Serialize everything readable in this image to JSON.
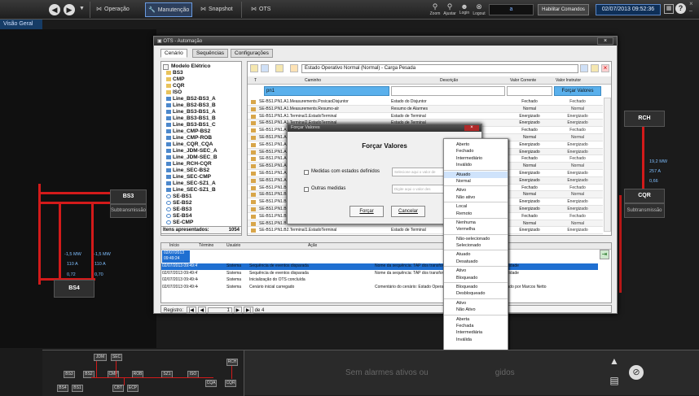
{
  "topbar": {
    "nav": {
      "operacao": "Operação",
      "manutencao": "Manutenção",
      "snapshot": "Snapshot",
      "ots": "OTS"
    },
    "tools": {
      "zoom": "Zoom",
      "ajustar": "Ajustar",
      "login": "Login",
      "logout": "Logout"
    },
    "user": "a",
    "habilitar": "Habilitar Comandos",
    "datetime": "02/07/2013 09:52:36"
  },
  "side_tab": "Visão Geral",
  "map": {
    "bs3": "BS3",
    "bs3_sub": "Subtransmissão",
    "bs4": "BS4",
    "rch": "RCH",
    "cqr": "CQR",
    "cqr_sub": "Subtransmissão",
    "m1": "-1,5 MW",
    "m2": "-1,5 MW",
    "m3": "110 A",
    "m4": "110 A",
    "m5": "0,72",
    "m6": "0,70",
    "m7": "19,2 MW",
    "m8": "257 A",
    "m9": "0,66"
  },
  "window": {
    "title": "OTS - Automação",
    "tabs": [
      "Cenário",
      "Sequências",
      "Configurações"
    ],
    "tree_root": "Modelo Elétrico",
    "tree": [
      "BS3",
      "CMP",
      "CQR",
      "ISO",
      "Line_BS2-BS3_A",
      "Line_BS2-BS3_B",
      "Line_BS3-BS1_A",
      "Line_BS3-BS1_B",
      "Line_BS3-BS1_C",
      "Line_CMP-BS2",
      "Line_CMP-ROB",
      "Line_CQR_CQA",
      "Line_JDM-SEC_A",
      "Line_JDM-SEC_B",
      "Line_RCH-CQR",
      "Line_SEC-BS2",
      "Line_SEC-CMP",
      "Line_SEC-SZ1_A",
      "Line_SEC-SZ1_B",
      "SE-BS1",
      "SE-BS2",
      "SE-BS3",
      "SE-BS4",
      "SE-CMP"
    ],
    "items_label": "Itens apresentados:",
    "items_count": "1054",
    "combo": "Estado Operativo Normal (Normal) - Carga Pesada",
    "cols": {
      "t": "T",
      "caminho": "Caminho",
      "descricao": "Descrição",
      "valor_corrente": "Valor Corrente",
      "valor_instrutor": "Valor Instrutor"
    },
    "filter_text": "pn1",
    "forcar_valores": "Forçar Valores",
    "rows": [
      [
        "SE-BS1.PN1.A1.Measurements.PosicaoDisjuntor",
        "Estado do Disjuntor",
        "Fechado",
        "Fechado"
      ],
      [
        "SE-BS1.PN1.A1.Measurements.Resumo-alr",
        "Resumo de Alarmes",
        "Normal",
        "Normal"
      ],
      [
        "SE-BS1.PN1.A1.Terminal1.EstadoTerminal",
        "Estado de Terminal",
        "Energizado",
        "Energizado"
      ],
      [
        "SE-BS1.PN1.A1.Terminal2.EstadoTerminal",
        "Estado de Terminal",
        "Energizado",
        "Energizado"
      ],
      [
        "SE-BS1.PN1.A2.Measurements.PosicaoDisjuntor",
        "Estado do Disjuntor",
        "Fechado",
        "Fechado"
      ],
      [
        "SE-BS1.PN1.A2",
        "",
        "Normal",
        "Normal"
      ],
      [
        "SE-BS1.PN1.A2",
        "",
        "Energizado",
        "Energizado"
      ],
      [
        "SE-BS1.PN1.A2",
        "",
        "Energizado",
        "Energizado"
      ],
      [
        "SE-BS1.PN1.A3",
        "",
        "Fechado",
        "Fechado"
      ],
      [
        "SE-BS1.PN1.A3",
        "",
        "Normal",
        "Normal"
      ],
      [
        "SE-BS1.PN1.A3",
        "",
        "Energizado",
        "Energizado"
      ],
      [
        "SE-BS1.PN1.A3",
        "",
        "Energizado",
        "Energizado"
      ],
      [
        "SE-BS1.PN1.B",
        "",
        "Fechado",
        "Fechado"
      ],
      [
        "SE-BS1.PN1.B",
        "",
        "Normal",
        "Normal"
      ],
      [
        "SE-BS1.PN1.B",
        "",
        "Energizado",
        "Energizado"
      ],
      [
        "SE-BS1.PN1.B",
        "",
        "Energizado",
        "Energizado"
      ],
      [
        "SE-BS1.PN1.B1",
        "",
        "Fechado",
        "Fechado"
      ],
      [
        "SE-BS1.PN1.B1",
        "",
        "Normal",
        "Normal"
      ],
      [
        "SE-BS1.PN1.B2.Terminal1.EstadoTerminal",
        "Estado de Terminal",
        "Energizado",
        "Energizado"
      ]
    ],
    "ev_cols": {
      "inicio": "Início",
      "termino": "Término",
      "usuario": "Usuário",
      "acao": "Ação"
    },
    "ev_filter": "02/07/2013 09:49:24",
    "events": [
      [
        "02/07/2013 09:49:47",
        "Sistema",
        "Sequência de eventos disparada",
        "Nome da sequência: TAP dos transforma",
        "ualidade"
      ],
      [
        "02/07/2013 09:49:47",
        "Sistema",
        "Sequência de eventos disparada",
        "Nome da sequência: TAP dos transforma",
        "ualidade"
      ],
      [
        "02/07/2013 09:49:44",
        "Sistema",
        "Inicialização do OTS concluída",
        "",
        ""
      ],
      [
        "02/07/2013 09:49:44",
        "Sistema",
        "Cenário inicial carregado",
        "Comentário do cenário: Estado Operativo",
        "erado por Marcos Netto"
      ]
    ],
    "registro": "Registro:",
    "reg_page": "1",
    "reg_of": "de 4"
  },
  "dialog": {
    "title": "Forçar Valores",
    "heading": "Forçar Valores",
    "opt1": "Medidas com estados definidos",
    "opt2": "Outras medidas",
    "ph1": "Selecione aqui o valor de",
    "ph2": "Digite aqui o valor des",
    "forcar": "Forçar",
    "cancelar": "Cancelar"
  },
  "dropdown": [
    "Aberto",
    "Fechado",
    "Intermediário",
    "Inválido",
    "Atuado",
    "Normal",
    "Ativo",
    "Não ativo",
    "Local",
    "Remoto",
    "Nenhuma",
    "Vermelha",
    "Não-selecionado",
    "Selecionado",
    "Atuado",
    "Desatuado",
    "Ativo",
    "Bloqueado",
    "Bloqueado",
    "Desbloqueado",
    "Ativo",
    "Não Ativo",
    "Aberta",
    "Fechada",
    "Intermediária",
    "Inválida"
  ],
  "bottom": {
    "alarms": "Sem alarmes ativos ou",
    "alarms_tail": "gidos",
    "minis": [
      "JDM",
      "SEC",
      "RCH",
      "BS3",
      "BS2",
      "CMP",
      "ROB",
      "SZ1",
      "ISO",
      "CQA",
      "CQR",
      "BS4",
      "BS1",
      "CBT",
      "ECP"
    ]
  },
  "colors": {
    "accent": "#1f6fd1",
    "line": "#d31a1a",
    "bar": "#2a2a2a"
  }
}
